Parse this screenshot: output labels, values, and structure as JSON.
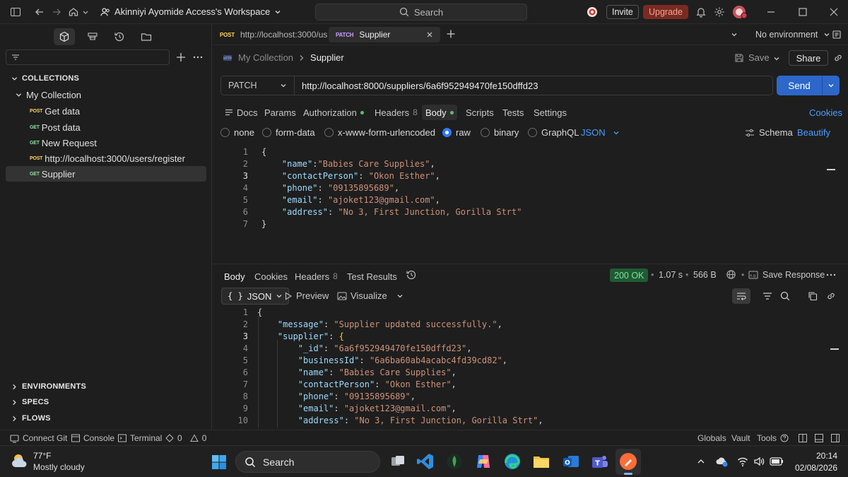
{
  "titlebar": {
    "workspace": "Akinniyi Ayomide Access's Workspace",
    "search_placeholder": "Search",
    "invite": "Invite",
    "upgrade": "Upgrade"
  },
  "sidebar": {
    "collections_label": "COLLECTIONS",
    "collection_name": "My Collection",
    "items": [
      {
        "method": "POST",
        "label": "Get data"
      },
      {
        "method": "GET",
        "label": "Post data"
      },
      {
        "method": "GET",
        "label": "New Request"
      },
      {
        "method": "POST",
        "label": "http://localhost:3000/users/register"
      },
      {
        "method": "GET",
        "label": "Supplier"
      }
    ],
    "sections": [
      "ENVIRONMENTS",
      "SPECS",
      "FLOWS"
    ]
  },
  "tabs": [
    {
      "method": "POST",
      "label": "http://localhost:3000/us"
    },
    {
      "method": "PATCH",
      "label": "Supplier"
    }
  ],
  "environment": "No environment",
  "breadcrumb": {
    "collection": "My Collection",
    "request": "Supplier"
  },
  "actions": {
    "save": "Save",
    "share": "Share"
  },
  "request": {
    "method": "PATCH",
    "url": "http://localhost:8000/suppliers/6a6f952949470fe150dffd23",
    "send": "Send",
    "tabs": {
      "docs": "Docs",
      "params": "Params",
      "authorization": "Authorization",
      "headers": "Headers",
      "headers_count": "8",
      "body": "Body",
      "scripts": "Scripts",
      "tests": "Tests",
      "settings": "Settings",
      "cookies": "Cookies"
    },
    "body_types": [
      "none",
      "form-data",
      "x-www-form-urlencoded",
      "raw",
      "binary",
      "GraphQL"
    ],
    "format": "JSON",
    "schema": "Schema",
    "beautify": "Beautify",
    "body_lines": [
      {
        "n": "1",
        "key": "",
        "val": "",
        "pre": "{",
        "post": ""
      },
      {
        "n": "2",
        "key": "\"name\"",
        "val": "\"Babies Care Supplies\"",
        "pre": "    ",
        "post": ","
      },
      {
        "n": "3",
        "key": "\"contactPerson\"",
        "val": "\"Okon Esther\"",
        "pre": "    ",
        "post": ","
      },
      {
        "n": "4",
        "key": "\"phone\"",
        "val": "\"09135895689\"",
        "pre": "    ",
        "post": ","
      },
      {
        "n": "5",
        "key": "\"email\"",
        "val": "\"ajoket123@gmail.com\"",
        "pre": "    ",
        "post": ","
      },
      {
        "n": "6",
        "key": "\"address\"",
        "val": "\"No 3, First Junction, Gorilla Strt\"",
        "pre": "    ",
        "post": ""
      },
      {
        "n": "7",
        "key": "",
        "val": "",
        "pre": "}",
        "post": ""
      }
    ]
  },
  "response": {
    "tabs": {
      "body": "Body",
      "cookies": "Cookies",
      "headers": "Headers",
      "headers_count": "8",
      "test_results": "Test Results"
    },
    "status": "200 OK",
    "time": "1.07 s",
    "size": "566 B",
    "save_response": "Save Response",
    "view_json": "JSON",
    "preview": "Preview",
    "visualize": "Visualize",
    "lines": [
      {
        "n": "1",
        "pre": "{",
        "key": "",
        "val": "",
        "post": ""
      },
      {
        "n": "2",
        "pre": "    ",
        "key": "\"message\"",
        "val": "\"Supplier updated successfully.\"",
        "post": ","
      },
      {
        "n": "3",
        "pre": "    ",
        "key": "\"supplier\"",
        "val": "",
        "post": " {"
      },
      {
        "n": "4",
        "pre": "        ",
        "key": "\"_id\"",
        "val": "\"6a6f952949470fe150dffd23\"",
        "post": ","
      },
      {
        "n": "5",
        "pre": "        ",
        "key": "\"businessId\"",
        "val": "\"6a6ba60ab4acabc4fd39cd82\"",
        "post": ","
      },
      {
        "n": "6",
        "pre": "        ",
        "key": "\"name\"",
        "val": "\"Babies Care Supplies\"",
        "post": ","
      },
      {
        "n": "7",
        "pre": "        ",
        "key": "\"contactPerson\"",
        "val": "\"Okon Esther\"",
        "post": ","
      },
      {
        "n": "8",
        "pre": "        ",
        "key": "\"phone\"",
        "val": "\"09135895689\"",
        "post": ","
      },
      {
        "n": "9",
        "pre": "        ",
        "key": "\"email\"",
        "val": "\"ajoket123@gmail.com\"",
        "post": ","
      },
      {
        "n": "10",
        "pre": "        ",
        "key": "\"address\"",
        "val": "\"No 3, First Junction, Gorilla Strt\"",
        "post": ","
      }
    ]
  },
  "statusbar": {
    "connect_git": "Connect Git",
    "console": "Console",
    "terminal": "Terminal",
    "errors": "0",
    "warnings": "0",
    "globals": "Globals",
    "vault": "Vault",
    "tools": "Tools"
  },
  "taskbar": {
    "temperature": "77°F",
    "weather": "Mostly cloudy",
    "search": "Search",
    "time": "20:14",
    "date": "02/08/2026"
  },
  "colors": {
    "accent": "#2c67c9",
    "status_ok": "#1f5b34",
    "upgrade": "#7b2a22"
  }
}
